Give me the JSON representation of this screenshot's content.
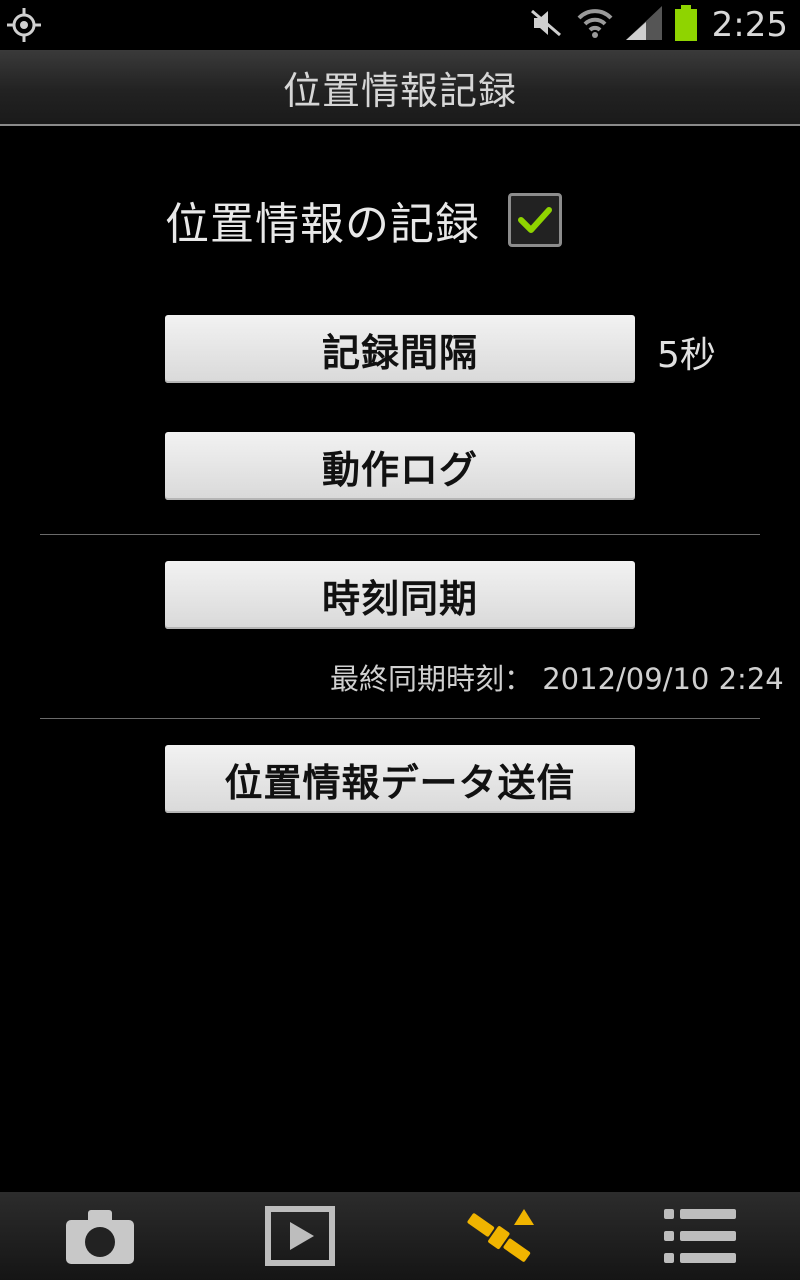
{
  "status": {
    "time": "2:25",
    "icons": [
      "gps-icon",
      "mute-icon",
      "wifi-icon",
      "signal-icon",
      "battery-icon"
    ]
  },
  "titlebar": {
    "title": "位置情報記録"
  },
  "record": {
    "label": "位置情報の記録",
    "checked": true
  },
  "interval": {
    "button_label": "記録間隔",
    "value": "5秒"
  },
  "log": {
    "button_label": "動作ログ"
  },
  "sync": {
    "button_label": "時刻同期",
    "last_sync_label": "最終同期時刻：",
    "last_sync_value": "2012/09/10 2:24"
  },
  "send": {
    "button_label": "位置情報データ送信"
  },
  "bottom_nav": {
    "items": [
      "camera-icon",
      "play-icon",
      "satellite-icon",
      "menu-list-icon"
    ],
    "active_index": 2
  },
  "colors": {
    "checkmark": "#8fd400",
    "satellite_active": "#f0b400"
  }
}
